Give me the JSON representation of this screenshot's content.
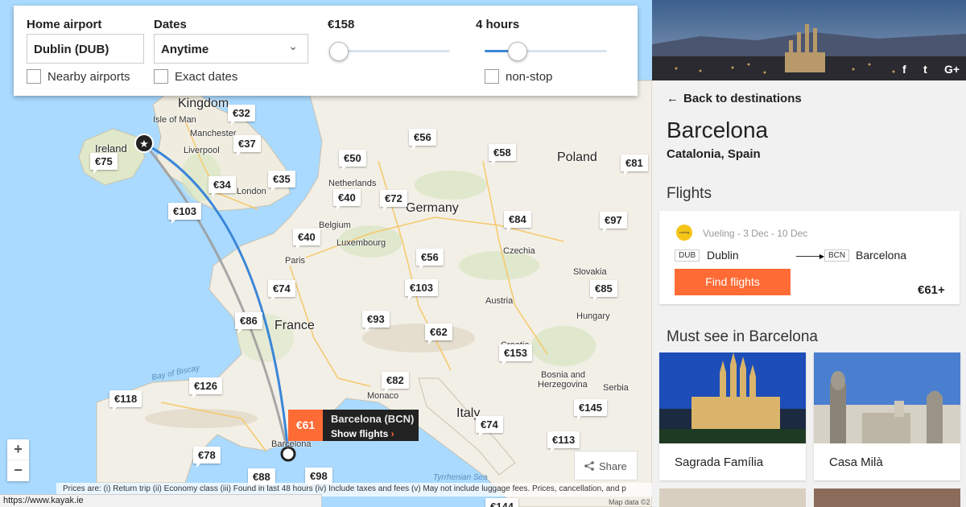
{
  "filter": {
    "home_airport_label": "Home airport",
    "home_airport_value": "Dublin (DUB)",
    "dates_label": "Dates",
    "dates_value": "Anytime",
    "price_label": "€158",
    "duration_label": "4 hours",
    "price_slider_level": 0.08,
    "duration_slider_level": 0.27,
    "nearby_label": "Nearby airports",
    "exact_label": "Exact dates",
    "nonstop_label": "non-stop"
  },
  "map": {
    "labels": {
      "kingdom": "Kingdom",
      "ireland": "Ireland",
      "isle_of_man": "Isle of Man",
      "manchester": "Manchester",
      "liverpool": "Liverpool",
      "london": "London",
      "netherlands": "Netherlands",
      "belgium": "Belgium",
      "luxembourg": "Luxembourg",
      "germany": "Germany",
      "poland": "Poland",
      "czechia": "Czechia",
      "slovakia": "Slovakia",
      "austria": "Austria",
      "hungary": "Hungary",
      "france": "France",
      "paris": "Paris",
      "monaco": "Monaco",
      "italy": "Italy",
      "bosnia": "Bosnia and",
      "herzegovina": "Herzegovina",
      "serbia": "Serbia",
      "croatia": "Croatia",
      "barcelona": "Barcelona",
      "bay_of_biscay": "Bay of Biscay",
      "tyrrhenian": "Tyrrhenian Sea"
    },
    "prices": [
      "€32",
      "€37",
      "€75",
      "€35",
      "€34",
      "€103",
      "€56",
      "€50",
      "€58",
      "€81",
      "€40",
      "€72",
      "€84",
      "€97",
      "€40",
      "€56",
      "€74",
      "€103",
      "€85",
      "€86",
      "€93",
      "€62",
      "€153",
      "€82",
      "€118",
      "€126",
      "€145",
      "€74",
      "€113",
      "€78",
      "€88",
      "€98",
      "€144"
    ],
    "selected": {
      "price": "€61",
      "name": "Barcelona (BCN)",
      "show_flights": "Show flights"
    },
    "zoom_in": "+",
    "zoom_out": "−",
    "share": "Share",
    "disclaimer": "Prices are: (i) Return trip (ii) Economy class (iii) Found in last 48 hours (iv) Include taxes and fees (v) May not include luggage fees. Prices, cancellation, and p",
    "map_data": "Map data ©2",
    "status_url": "https://www.kayak.ie"
  },
  "sidebar": {
    "social": [
      "f",
      "t",
      "G+"
    ],
    "back_label": "Back to destinations",
    "city": "Barcelona",
    "region": "Catalonia, Spain",
    "flights_heading": "Flights",
    "flight": {
      "airline_logo_text": "vueling",
      "airline_dates": "Vueling - 3 Dec - 10 Dec",
      "from_code": "DUB",
      "from_name": "Dublin",
      "to_code": "BCN",
      "to_name": "Barcelona",
      "find_label": "Find flights",
      "price": "€61+"
    },
    "must_see_heading": "Must see in Barcelona",
    "attractions": [
      {
        "name": "Sagrada Família"
      },
      {
        "name": "Casa Milà"
      }
    ]
  },
  "colors": {
    "accent": "#ff6b35",
    "route_blue": "#3a86d8",
    "route_gray": "#999999",
    "sea": "#aadaff",
    "land": "#f2efe6"
  }
}
